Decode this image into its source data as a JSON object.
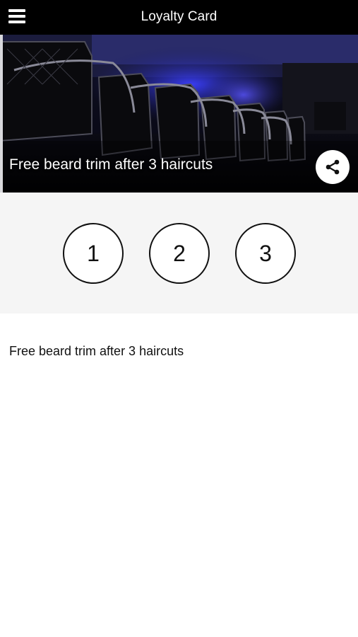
{
  "header": {
    "title": "Loyalty Card",
    "menu_icon": "hamburger-menu-icon"
  },
  "hero": {
    "image": "barbershop-chairs-photo",
    "caption": "Free beard trim after 3 haircuts",
    "share_icon": "share-icon"
  },
  "stamps": [
    {
      "label": "1"
    },
    {
      "label": "2"
    },
    {
      "label": "3"
    }
  ],
  "description": "Free beard trim after 3 haircuts",
  "colors": {
    "header_bg": "#000000",
    "stamp_area_bg": "#f5f5f5",
    "hero_accent": "#3a3dff"
  }
}
